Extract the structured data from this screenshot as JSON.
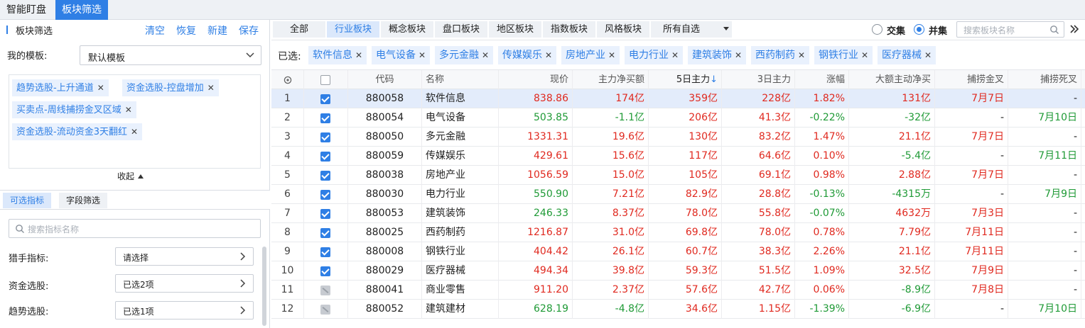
{
  "top_tabs": [
    "智能盯盘",
    "板块筛选"
  ],
  "left": {
    "title": "板块筛选",
    "actions": [
      "清空",
      "恢复",
      "新建",
      "保存"
    ],
    "template_label": "我的模板:",
    "template_value": "默认模板",
    "conditions": [
      "趋势选股-上升通道",
      "资金选股-控盘增加",
      "买卖点-周线捕捞金叉区域",
      "资金选股-流动资金3天翻红"
    ],
    "collapse_label": "收起",
    "sub_tabs": [
      "可选指标",
      "字段筛选"
    ],
    "search_placeholder": "搜索指标名称",
    "indicator_rows": [
      {
        "label": "猎手指标:",
        "value": "请选择"
      },
      {
        "label": "资金选股:",
        "value": "已选2项"
      },
      {
        "label": "趋势选股:",
        "value": "已选1项"
      }
    ]
  },
  "categories": [
    "全部",
    "行业板块",
    "概念板块",
    "盘口板块",
    "地区板块",
    "指数板块",
    "风格板块",
    "所有自选"
  ],
  "active_category": "行业板块",
  "mode": {
    "option1": "交集",
    "option2": "并集",
    "selected": "并集"
  },
  "sector_search_placeholder": "搜索板块名称",
  "selected_label": "已选:",
  "selected_sectors": [
    "软件信息",
    "电气设备",
    "多元金融",
    "传媒娱乐",
    "房地产业",
    "电力行业",
    "建筑装饰",
    "西药制药",
    "钢铁行业",
    "医疗器械"
  ],
  "table": {
    "headers": [
      "",
      "",
      "代码",
      "名称",
      "现价",
      "主力净买额",
      "5日主力",
      "3日主力",
      "涨幅",
      "大额主动净买",
      "捕捞金叉",
      "捕捞死叉"
    ],
    "sort_col_label": "5日主力",
    "sort_arrow": "↓",
    "rows": [
      {
        "n": "1",
        "chk": "on",
        "code": "880058",
        "name": "软件信息",
        "price": "838.86",
        "pc": "red",
        "main": "174亿",
        "mc": "red",
        "d5": "359亿",
        "d5c": "red",
        "d3": "228亿",
        "d3c": "red",
        "chg": "1.82%",
        "chc": "red",
        "big": "131亿",
        "bc": "red",
        "gold": "7月7日",
        "gc": "red",
        "dead": "-",
        "dc": "blk"
      },
      {
        "n": "2",
        "chk": "on",
        "code": "880054",
        "name": "电气设备",
        "price": "503.85",
        "pc": "green",
        "main": "-1.1亿",
        "mc": "green",
        "d5": "206亿",
        "d5c": "red",
        "d3": "41.3亿",
        "d3c": "red",
        "chg": "-0.22%",
        "chc": "green",
        "big": "-32亿",
        "bc": "green",
        "gold": "-",
        "gc": "blk",
        "dead": "7月10日",
        "dc": "green"
      },
      {
        "n": "3",
        "chk": "on",
        "code": "880050",
        "name": "多元金融",
        "price": "1331.31",
        "pc": "red",
        "main": "19.6亿",
        "mc": "red",
        "d5": "130亿",
        "d5c": "red",
        "d3": "83.2亿",
        "d3c": "red",
        "chg": "1.47%",
        "chc": "red",
        "big": "21.1亿",
        "bc": "red",
        "gold": "7月7日",
        "gc": "red",
        "dead": "-",
        "dc": "blk"
      },
      {
        "n": "4",
        "chk": "on",
        "code": "880059",
        "name": "传媒娱乐",
        "price": "429.61",
        "pc": "red",
        "main": "15.6亿",
        "mc": "red",
        "d5": "117亿",
        "d5c": "red",
        "d3": "64.6亿",
        "d3c": "red",
        "chg": "0.10%",
        "chc": "red",
        "big": "-5.4亿",
        "bc": "green",
        "gold": "-",
        "gc": "blk",
        "dead": "7月11日",
        "dc": "green"
      },
      {
        "n": "5",
        "chk": "on",
        "code": "880038",
        "name": "房地产业",
        "price": "1056.59",
        "pc": "red",
        "main": "15.0亿",
        "mc": "red",
        "d5": "105亿",
        "d5c": "red",
        "d3": "69.1亿",
        "d3c": "red",
        "chg": "0.98%",
        "chc": "red",
        "big": "2.88亿",
        "bc": "red",
        "gold": "7月7日",
        "gc": "red",
        "dead": "-",
        "dc": "blk"
      },
      {
        "n": "6",
        "chk": "on",
        "code": "880030",
        "name": "电力行业",
        "price": "550.90",
        "pc": "green",
        "main": "7.21亿",
        "mc": "red",
        "d5": "82.9亿",
        "d5c": "red",
        "d3": "28.8亿",
        "d3c": "red",
        "chg": "-0.13%",
        "chc": "green",
        "big": "-4315万",
        "bc": "green",
        "gold": "-",
        "gc": "blk",
        "dead": "7月9日",
        "dc": "green"
      },
      {
        "n": "7",
        "chk": "on",
        "code": "880053",
        "name": "建筑装饰",
        "price": "246.33",
        "pc": "green",
        "main": "8.37亿",
        "mc": "red",
        "d5": "78.0亿",
        "d5c": "red",
        "d3": "55.8亿",
        "d3c": "red",
        "chg": "-0.07%",
        "chc": "green",
        "big": "4632万",
        "bc": "red",
        "gold": "7月3日",
        "gc": "red",
        "dead": "-",
        "dc": "blk"
      },
      {
        "n": "8",
        "chk": "on",
        "code": "880025",
        "name": "西药制药",
        "price": "1216.87",
        "pc": "red",
        "main": "31.0亿",
        "mc": "red",
        "d5": "69.8亿",
        "d5c": "red",
        "d3": "78.0亿",
        "d3c": "red",
        "chg": "0.78%",
        "chc": "red",
        "big": "7.79亿",
        "bc": "red",
        "gold": "7月11日",
        "gc": "red",
        "dead": "-",
        "dc": "blk"
      },
      {
        "n": "9",
        "chk": "on",
        "code": "880008",
        "name": "钢铁行业",
        "price": "404.42",
        "pc": "red",
        "main": "26.1亿",
        "mc": "red",
        "d5": "60.7亿",
        "d5c": "red",
        "d3": "38.3亿",
        "d3c": "red",
        "chg": "2.26%",
        "chc": "red",
        "big": "21.1亿",
        "bc": "red",
        "gold": "7月11日",
        "gc": "red",
        "dead": "-",
        "dc": "blk"
      },
      {
        "n": "10",
        "chk": "on",
        "code": "880029",
        "name": "医疗器械",
        "price": "494.34",
        "pc": "red",
        "main": "39.8亿",
        "mc": "red",
        "d5": "59.3亿",
        "d5c": "red",
        "d3": "51.5亿",
        "d3c": "red",
        "chg": "1.09%",
        "chc": "red",
        "big": "32.5亿",
        "bc": "red",
        "gold": "7月9日",
        "gc": "red",
        "dead": "-",
        "dc": "blk"
      },
      {
        "n": "11",
        "chk": "dis",
        "code": "880041",
        "name": "商业零售",
        "price": "911.20",
        "pc": "red",
        "main": "2.37亿",
        "mc": "red",
        "d5": "57.6亿",
        "d5c": "red",
        "d3": "42.7亿",
        "d3c": "red",
        "chg": "0.06%",
        "chc": "red",
        "big": "-8.9亿",
        "bc": "green",
        "gold": "7月8日",
        "gc": "red",
        "dead": "-",
        "dc": "blk"
      },
      {
        "n": "12",
        "chk": "dis",
        "code": "880052",
        "name": "建筑建材",
        "price": "628.19",
        "pc": "green",
        "main": "-4.8亿",
        "mc": "green",
        "d5": "34.6亿",
        "d5c": "red",
        "d3": "1.15亿",
        "d3c": "red",
        "chg": "-1.39%",
        "chc": "green",
        "big": "-6.9亿",
        "bc": "green",
        "gold": "-",
        "gc": "blk",
        "dead": "7月10日",
        "dc": "green"
      }
    ]
  },
  "colors": {
    "accent": "#2f7fe5",
    "up": "#e0291f",
    "down": "#1f9a36",
    "selected_row": "#e3ecfb"
  },
  "icons": {
    "template_dropdown": "chevron-down-icon",
    "search": "search-icon",
    "more": "double-chevron-right-icon"
  }
}
